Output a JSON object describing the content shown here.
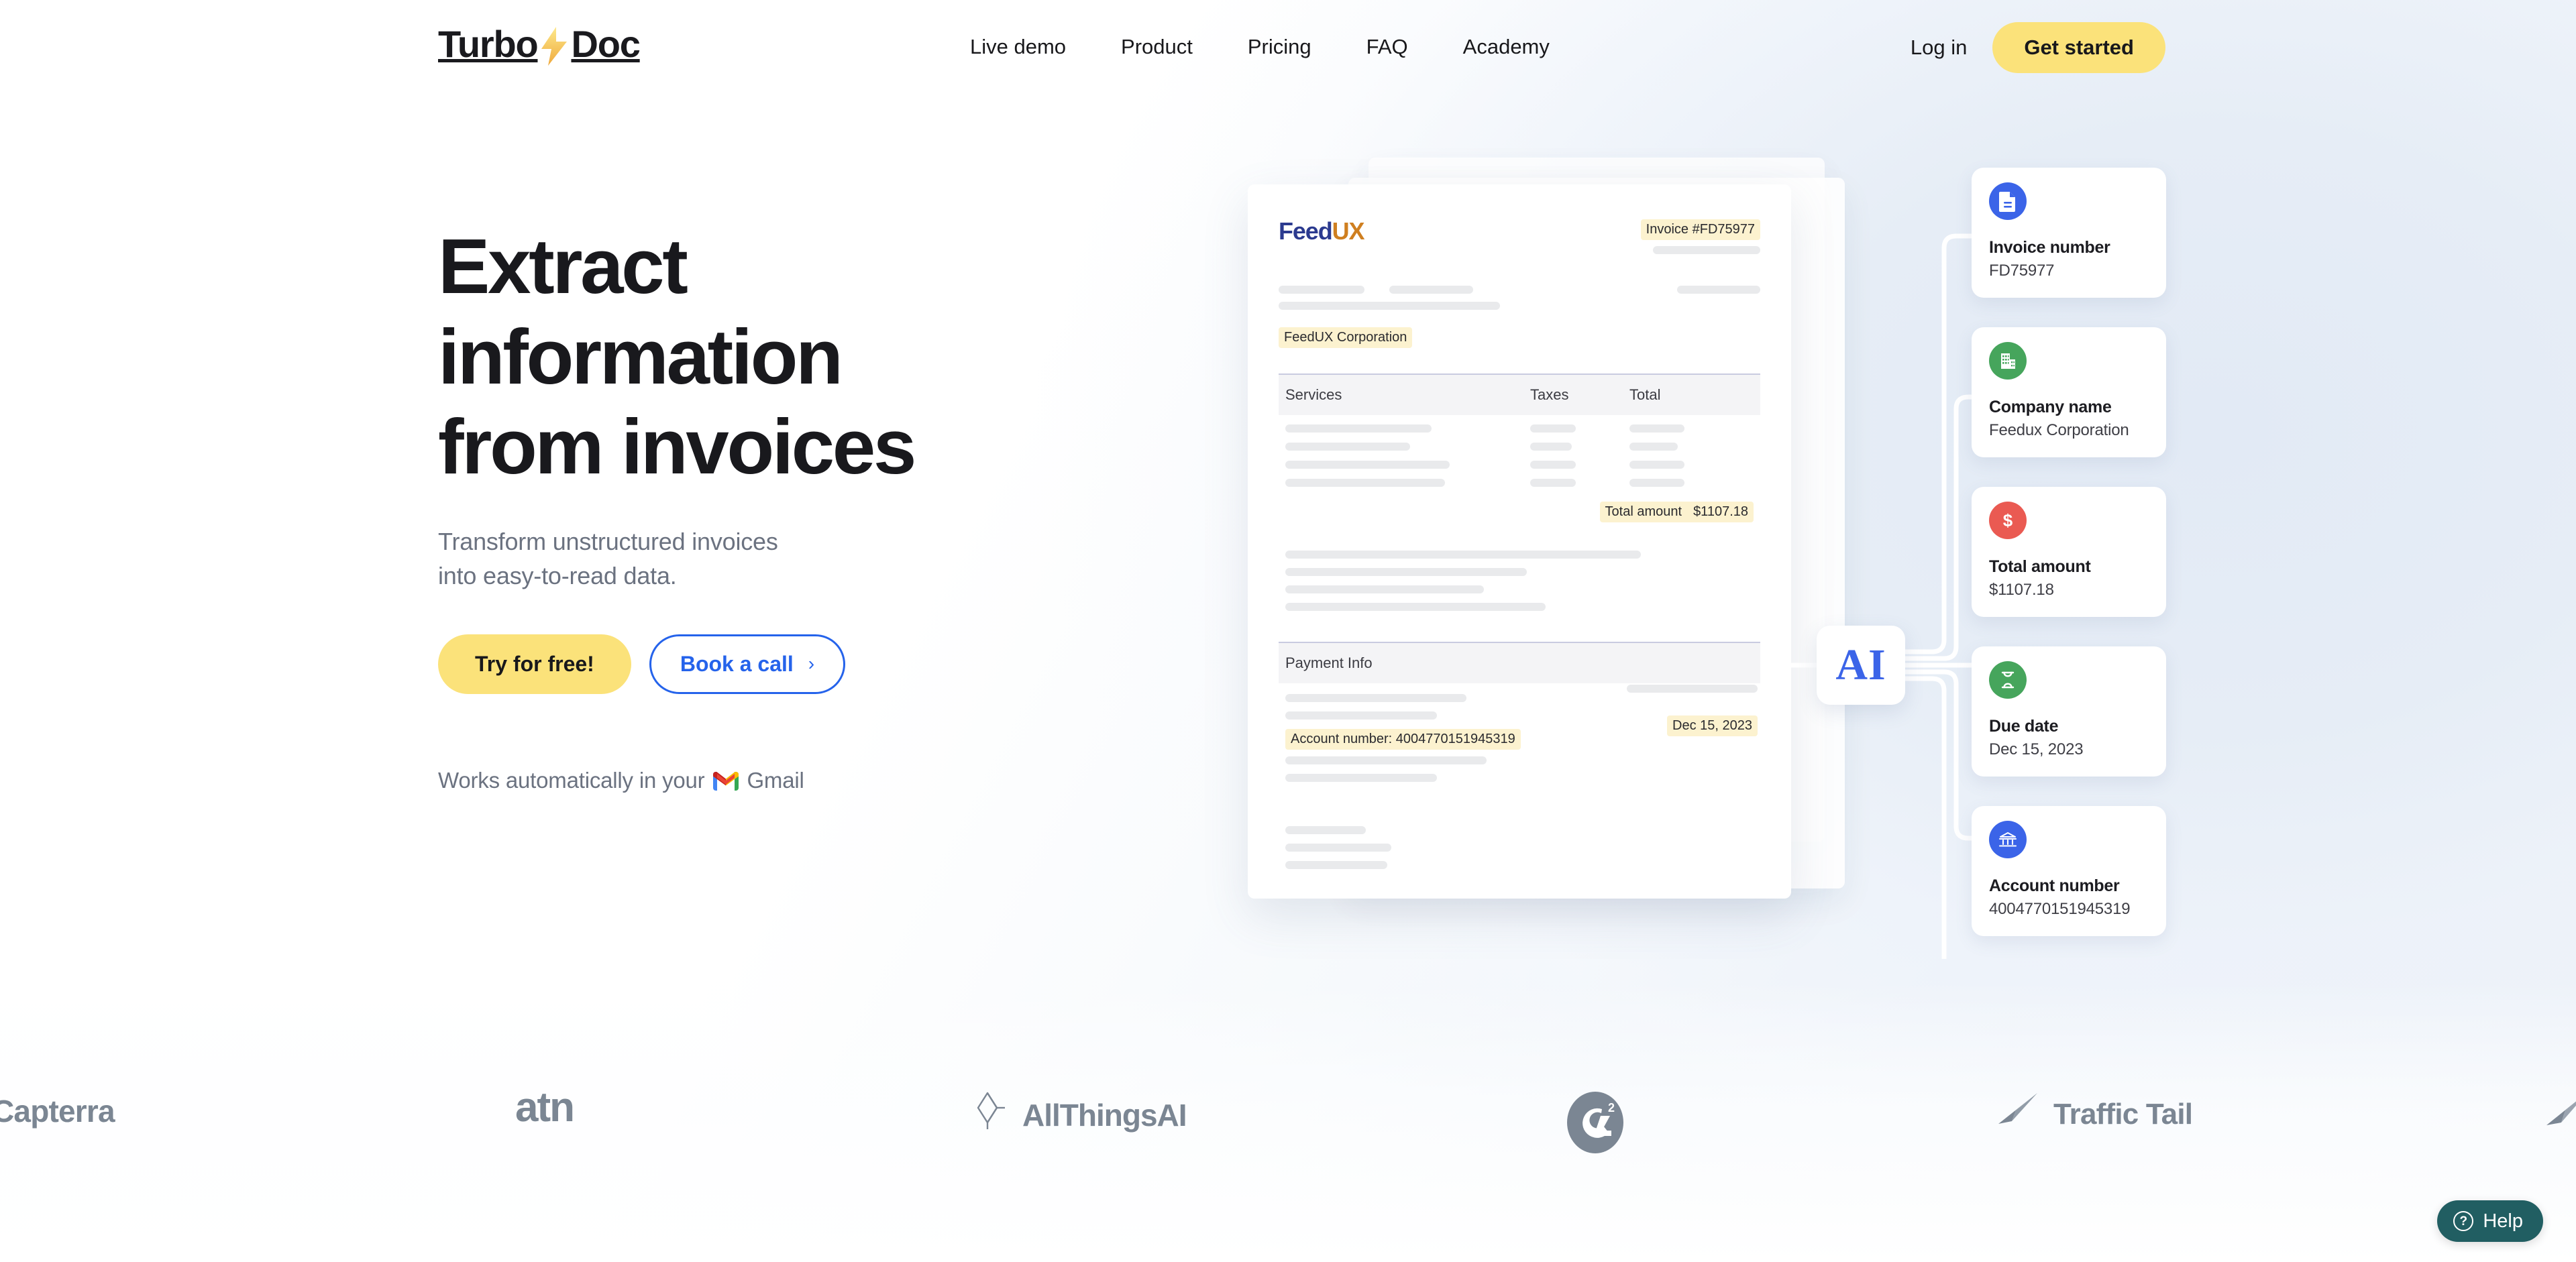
{
  "brand": {
    "name_part1": "Turbo",
    "name_part2": "Doc",
    "bolt_icon": "lightning-bolt-icon",
    "accent_yellow": "#fbe27a",
    "accent_blue": "#2563eb"
  },
  "nav": {
    "items": [
      {
        "label": "Live demo"
      },
      {
        "label": "Product"
      },
      {
        "label": "Pricing"
      },
      {
        "label": "FAQ"
      },
      {
        "label": "Academy"
      }
    ],
    "login_label": "Log in",
    "get_started_label": "Get started"
  },
  "hero": {
    "title_line1": "Extract",
    "title_line2": "information",
    "title_line3": "from invoices",
    "subtitle_line1": "Transform unstructured invoices",
    "subtitle_line2": "into easy-to-read data.",
    "primary_cta": "Try for free!",
    "secondary_cta": "Book a call",
    "secondary_cta_chevron": "›",
    "note_prefix": "Works automatically in your",
    "note_suffix": "Gmail"
  },
  "invoice": {
    "logo_part1": "Feed",
    "logo_part2": "UX",
    "invoice_number_label": "Invoice #FD75977",
    "company_highlight": "FeedUX Corporation",
    "table_headers": {
      "services": "Services",
      "taxes": "Taxes",
      "total": "Total"
    },
    "total_amount_label": "Total amount",
    "total_amount_value": "$1107.18",
    "payment_info_heading": "Payment Info",
    "account_number_highlight": "Account number: 4004770151945319",
    "due_date_highlight": "Dec 15, 2023"
  },
  "ai_node": {
    "label": "AI"
  },
  "extracted": {
    "cards": [
      {
        "icon": "document-icon",
        "icon_color": "#3b64e8",
        "label": "Invoice number",
        "value": "FD75977"
      },
      {
        "icon": "building-icon",
        "icon_color": "#46a55c",
        "label": "Company name",
        "value": "Feedux Corporation"
      },
      {
        "icon": "dollar-icon",
        "icon_color": "#ea5a52",
        "label": "Total amount",
        "value": "$1107.18"
      },
      {
        "icon": "hourglass-icon",
        "icon_color": "#46a55c",
        "label": "Due date",
        "value": "Dec 15, 2023"
      },
      {
        "icon": "bank-icon",
        "icon_color": "#3b64e8",
        "label": "Account number",
        "value": "4004770151945319"
      }
    ]
  },
  "logo_strip": {
    "items": [
      {
        "name": "capterra",
        "label": "Capterra"
      },
      {
        "name": "atn",
        "label": "atn"
      },
      {
        "name": "allthingsai",
        "label": "AllThingsAI"
      },
      {
        "name": "g2",
        "label": ""
      },
      {
        "name": "traffic-tail",
        "label": "Traffic Tail"
      }
    ]
  },
  "help": {
    "label": "Help",
    "icon": "question-mark-icon",
    "background": "#215e62"
  }
}
